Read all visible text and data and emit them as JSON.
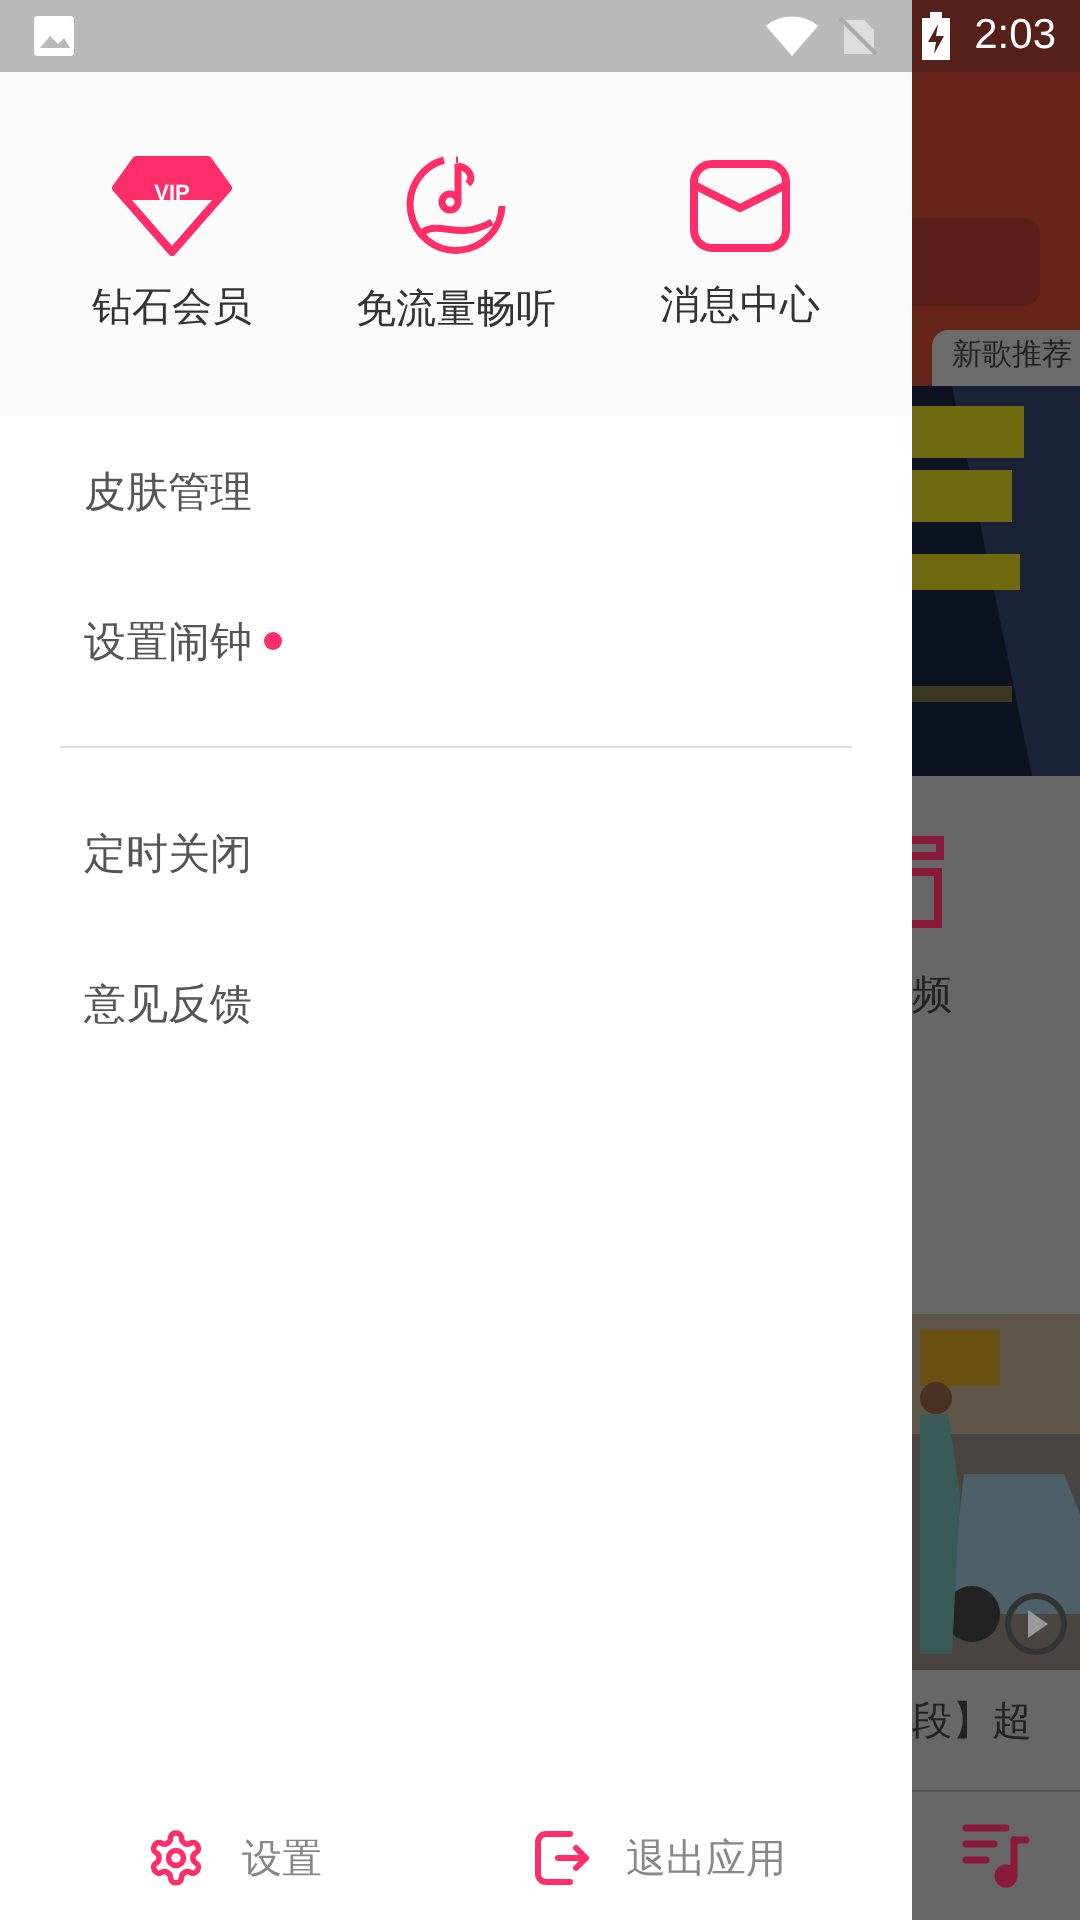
{
  "status_bar": {
    "time": "2:03"
  },
  "drawer": {
    "quick_actions": [
      {
        "kind": "vip",
        "label": "钻石会员",
        "badge_text": "VIP"
      },
      {
        "kind": "music",
        "label": "免流量畅听"
      },
      {
        "kind": "mail",
        "label": "消息中心"
      }
    ],
    "menu_groups": [
      [
        {
          "label": "皮肤管理",
          "dot": false
        },
        {
          "label": "设置闹钟",
          "dot": true
        }
      ],
      [
        {
          "label": "定时关闭",
          "dot": false
        },
        {
          "label": "意见反馈",
          "dot": false
        }
      ]
    ],
    "footer": [
      {
        "kind": "settings",
        "label": "设置"
      },
      {
        "kind": "exit",
        "label": "退出应用"
      }
    ]
  },
  "background_app": {
    "tab": "新歌推荐",
    "category_label": "频",
    "video_title": "段】超"
  }
}
